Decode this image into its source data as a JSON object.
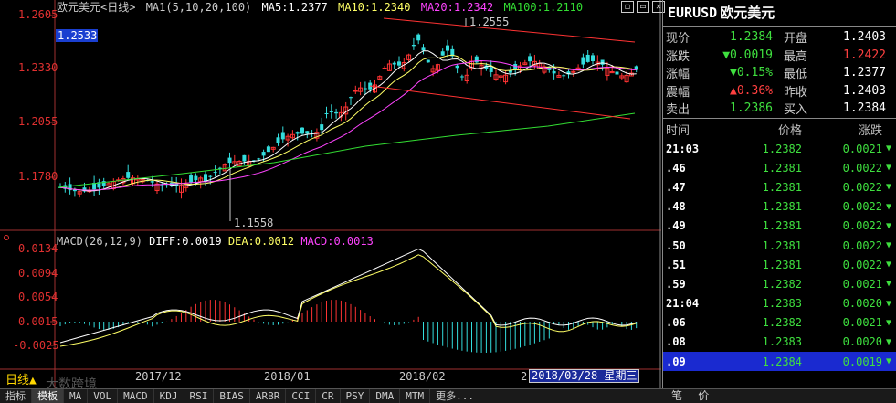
{
  "chart_header": {
    "title": "欧元美元<日线>",
    "ma_params": "MA1(5,10,20,100)",
    "ma5": "MA5:1.2377",
    "ma10": "MA10:1.2340",
    "ma20": "MA20:1.2342",
    "ma100": "MA100:1.2110",
    "colors": {
      "ma5": "#ffffff",
      "ma10": "#ffff66",
      "ma20": "#ff44ff",
      "ma100": "#33dd33"
    }
  },
  "window_buttons": [
    "◻",
    "▭",
    "✕"
  ],
  "price_axis": {
    "labels": [
      "1.2605",
      "1.2330",
      "1.2055",
      "1.1780"
    ],
    "current_price": "1.2533"
  },
  "annotations": {
    "high": "1.2555",
    "low": "1.1558"
  },
  "macd_header": {
    "params": "MACD(26,12,9)",
    "diff": "DIFF:0.0019",
    "dea": "DEA:0.0012",
    "macd": "MACD:0.0013"
  },
  "macd_axis": {
    "labels": [
      "0.0134",
      "0.0094",
      "0.0054",
      "0.0015",
      "-0.0025"
    ]
  },
  "time_axis": {
    "labels": [
      "2017/12",
      "2018/01",
      "2018/02",
      "2"
    ],
    "cursor_date": "2018/03/28 星期三"
  },
  "period_label": "日线▲",
  "watermark": "大数跨境",
  "bottom_tabs": [
    "指标",
    "模板",
    "MA",
    "VOL",
    "MACD",
    "KDJ",
    "RSI",
    "BIAS",
    "ARBR",
    "CCI",
    "CR",
    "PSY",
    "DMA",
    "MTM",
    "更多..."
  ],
  "symbol": {
    "code": "EURUSD",
    "name": "欧元美元"
  },
  "quote": [
    {
      "l1": "现价",
      "v1": "1.2384",
      "l2": "开盘",
      "v2": "1.2403",
      "v1_up": false
    },
    {
      "l1": "涨跌",
      "v1": "▼0.0019",
      "l2": "最高",
      "v2": "1.2422",
      "v1_up": false,
      "v2_up": true
    },
    {
      "l1": "涨幅",
      "v1": "▼0.15%",
      "l2": "最低",
      "v2": "1.2377",
      "v1_up": false
    },
    {
      "l1": "震幅",
      "v1": "▲0.36%",
      "l2": "昨收",
      "v2": "1.2403",
      "v1_up": true
    },
    {
      "l1": "卖出",
      "v1": "1.2386",
      "l2": "买入",
      "v2": "1.2384",
      "v1_up": false
    }
  ],
  "tick_header": {
    "time": "时间",
    "price": "价格",
    "change": "涨跌"
  },
  "ticks": [
    {
      "t": "21:03",
      "p": "1.2382",
      "c": "0.0021"
    },
    {
      "t": ".46",
      "p": "1.2381",
      "c": "0.0022"
    },
    {
      "t": ".47",
      "p": "1.2381",
      "c": "0.0022"
    },
    {
      "t": ".48",
      "p": "1.2381",
      "c": "0.0022"
    },
    {
      "t": ".49",
      "p": "1.2381",
      "c": "0.0022"
    },
    {
      "t": ".50",
      "p": "1.2381",
      "c": "0.0022"
    },
    {
      "t": ".51",
      "p": "1.2381",
      "c": "0.0022"
    },
    {
      "t": ".59",
      "p": "1.2382",
      "c": "0.0021"
    },
    {
      "t": "21:04",
      "p": "1.2383",
      "c": "0.0020"
    },
    {
      "t": ".06",
      "p": "1.2382",
      "c": "0.0021"
    },
    {
      "t": ".08",
      "p": "1.2383",
      "c": "0.0020"
    },
    {
      "t": ".09",
      "p": "1.2384",
      "c": "0.0019"
    }
  ],
  "ticks_arrow": "▼",
  "side_footer": {
    "left": "笔",
    "right": "价"
  }
}
